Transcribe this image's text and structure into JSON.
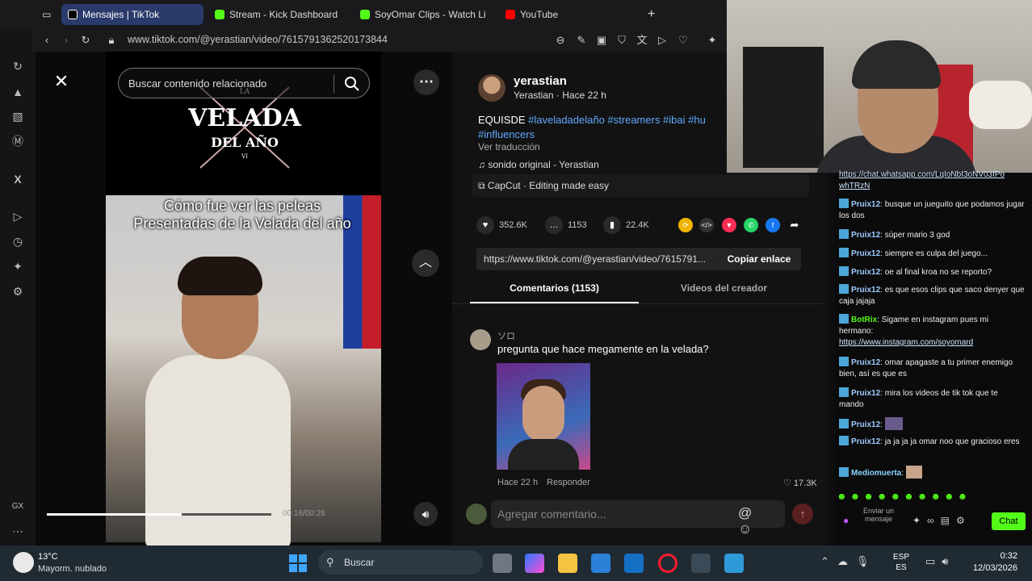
{
  "browser": {
    "tabs": [
      {
        "label": "Mensajes | TikTok",
        "active": true,
        "color": "#ffffff"
      },
      {
        "label": "Stream - Kick Dashboard",
        "active": false,
        "color": "#53fc18"
      },
      {
        "label": "SoyOmar Clips - Watch Li",
        "active": false,
        "color": "#53fc18"
      },
      {
        "label": "YouTube",
        "active": false,
        "color": "#ff0000"
      }
    ],
    "new_tab": "+",
    "url": "www.tiktok.com/@yerastian/video/7615791362520173844"
  },
  "video": {
    "search_placeholder": "Buscar contenido relacionado",
    "logo_line1": "LA",
    "logo_line2": "VELADA",
    "logo_line3": "DEL AÑO",
    "logo_line4": "VI",
    "caption": "Cómo fue ver las peleas Presentadas de la Velada del año",
    "time": "00:16/00:26",
    "progress": 0.6
  },
  "post": {
    "author": "yerastian",
    "meta": "Yerastian · Hace 22 h",
    "desc_text": "EQUISDE ",
    "hashtags": "#laveladadelaño #streamers #ibai #hu",
    "hashtags_2": "#influencers",
    "translate": "Ver traducción",
    "sound": "sonido original - Yerastian",
    "capcut": "CapCut · Editing made easy",
    "likes": "352.6K",
    "comments": "1153",
    "saves": "22.4K",
    "link": "https://www.tiktok.com/@yerastian/video/7615791...",
    "copy_label": "Copiar enlace",
    "tab_comments": "Comentarios (1153)",
    "tab_videos": "Videos del creador"
  },
  "comment": {
    "user": "ソロ",
    "text": "pregunta que hace megamente en la velada?",
    "time": "Hace 22 h",
    "reply": "Responder",
    "likes": "17.3K"
  },
  "add_comment": {
    "placeholder": "Agregar comentario...",
    "icons": "@ ☺"
  },
  "chat": {
    "lines": [
      {
        "user": "",
        "text": "",
        "link": "https://chat.whatsapp.com/LqIoNbI3oNV03fPo whTRzN"
      },
      {
        "user": "Pruix12",
        "text": ": busque un jueguito que podamos jugar los dos"
      },
      {
        "user": "Pruix12",
        "text": ": súper mario 3 god"
      },
      {
        "user": "Pruix12",
        "text": ": siempre es culpa del juego..."
      },
      {
        "user": "Pruix12",
        "text": ": oe al final kroa no se reporto?"
      },
      {
        "user": "Pruix12",
        "text": ": es que esos clips que saco denyer que caja jajaja"
      },
      {
        "user": "BotRix",
        "text": ": Sigame en instagram pues mi hermano:",
        "link": "https://www.instagram.com/soyomard"
      },
      {
        "user": "Pruix12",
        "text": ": omar apagaste a tu primer enemigo bien, así es que es"
      },
      {
        "user": "Pruix12",
        "text": ": mira los videos de tik tok que te mando"
      },
      {
        "user": "Pruix12",
        "text": ":"
      },
      {
        "user": "Pruix12",
        "text": ": ja ja ja ja omar noo que gracioso eres"
      },
      {
        "user": "Mediomuerta",
        "text": ":"
      }
    ],
    "send_label": "Enviar un mensaje",
    "chat_button": "Chat"
  },
  "taskbar": {
    "temp": "13°C",
    "weather": "Mayorm. nublado",
    "search": "Buscar",
    "lang_1": "ESP",
    "lang_2": "ES",
    "time": "0:32",
    "date": "12/03/2026"
  },
  "colors": {
    "accent_hashtag": "#60a8ff",
    "kick_green": "#53fc18"
  }
}
